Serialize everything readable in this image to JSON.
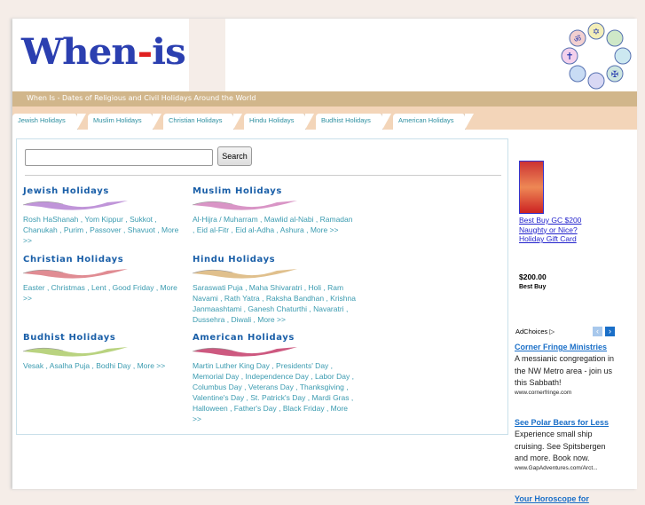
{
  "header": {
    "logo_text": "When-is",
    "logo_main": "When",
    "logo_dash": "-",
    "logo_end": "is",
    "banner": "When Is - Dates of Religious and Civil Holidays Around the World"
  },
  "tabs": [
    "Jewish Holidays",
    "Muslim Holidays",
    "Christian Holidays",
    "Hindu Holidays",
    "Budhist Holidays",
    "American Holidays"
  ],
  "search": {
    "value": "",
    "button": "Search"
  },
  "sections": [
    {
      "title": "Jewish Holidays",
      "color": "#b07ad0",
      "links": [
        "Rosh HaShanah",
        "Yom Kippur",
        "Sukkot",
        "Chanukah",
        "Purim",
        "Passover",
        "Shavuot",
        "More >>"
      ]
    },
    {
      "title": "Muslim Holidays",
      "color": "#d07ab8",
      "links": [
        "Al-Hijra / Muharram",
        "Mawlid al-Nabi",
        "Ramadan",
        "Eid al-Fitr",
        "Eid al-Adha",
        "Ashura",
        "More >>"
      ]
    },
    {
      "title": "Christian Holidays",
      "color": "#d86f78",
      "links": [
        "Easter",
        "Christmas",
        "Lent",
        "Good Friday",
        "More >>"
      ]
    },
    {
      "title": "Hindu Holidays",
      "color": "#d8b070",
      "links": [
        "Saraswati Puja",
        "Maha Shivaratri",
        "Holi",
        "Ram Navami",
        "Rath Yatra",
        "Raksha Bandhan",
        "Krishna Janmaashtami",
        "Ganesh Chaturthi",
        "Navaratri",
        "Dussehra",
        "Diwali",
        "More >>"
      ]
    },
    {
      "title": "Budhist Holidays",
      "color": "#a8c860",
      "links": [
        "Vesak",
        "Asalha Puja",
        "Bodhi Day",
        "More >>"
      ]
    },
    {
      "title": "American Holidays",
      "color": "#c03060",
      "links": [
        "Martin Luther King Day",
        "Presidents' Day",
        "Memorial Day",
        "Independence Day",
        "Labor Day",
        "Columbus Day",
        "Veterans Day",
        "Thanksgiving",
        "Valentine's Day",
        "St. Patrick's Day",
        "Mardi Gras",
        "Halloween",
        "Father's Day",
        "Black Friday",
        "More >>"
      ]
    }
  ],
  "sidebar": {
    "product": {
      "title": "Best Buy GC $200 Naughty or Nice? Holiday Gift Card",
      "price": "$200.00",
      "seller": "Best Buy"
    },
    "adchoices": "AdChoices ▷",
    "ads": [
      {
        "title": "Corner Fringe Ministries",
        "desc": "A messianic congregation in the NW Metro area - join us this Sabbath!",
        "url": "www.cornerfringe.com"
      },
      {
        "title": "See Polar Bears for Less",
        "desc": "Experience small ship cruising. See Spitsbergen and more. Book now.",
        "url": "www.GapAdventures.com/Arct..."
      },
      {
        "title": "Your Horoscope for",
        "desc": "",
        "url": ""
      }
    ]
  }
}
